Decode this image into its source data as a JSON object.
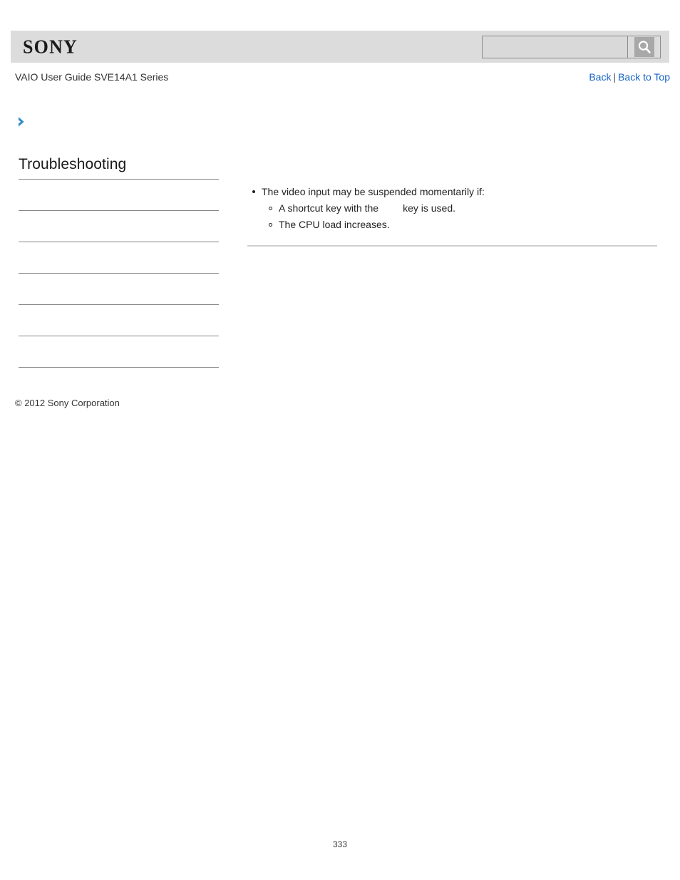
{
  "header": {
    "logo_text": "SONY",
    "logo_icon": "sony-wordmark",
    "search": {
      "value": "",
      "placeholder": "",
      "button_icon": "search-icon",
      "button_label": "Search"
    }
  },
  "title_row": {
    "guide_title": "VAIO User Guide SVE14A1 Series",
    "links": {
      "back": "Back",
      "separator": "|",
      "back_to_top": "Back to Top"
    }
  },
  "breadcrumb": {
    "icon": "chevron-right-icon"
  },
  "sidebar": {
    "heading": "Troubleshooting",
    "items": [
      {
        "label": ""
      },
      {
        "label": ""
      },
      {
        "label": ""
      },
      {
        "label": ""
      },
      {
        "label": ""
      },
      {
        "label": ""
      }
    ]
  },
  "copyright": "© 2012 Sony Corporation",
  "content": {
    "bullets": [
      {
        "text": "The video input may be suspended momentarily if:",
        "sub": [
          {
            "text_before": "A shortcut key with the",
            "missing_image": "fn-key-image",
            "text_after": "key is used."
          },
          {
            "text_before": "The CPU load increases.",
            "missing_image": "",
            "text_after": ""
          }
        ]
      }
    ]
  },
  "footer": {
    "page_number": "333"
  },
  "colors": {
    "header_bg": "#dcdcdc",
    "link_blue": "#1562c6",
    "chevron_blue": "#2e8bc9",
    "rule_gray": "#878787",
    "content_rule_gray": "#cfcfcf"
  }
}
